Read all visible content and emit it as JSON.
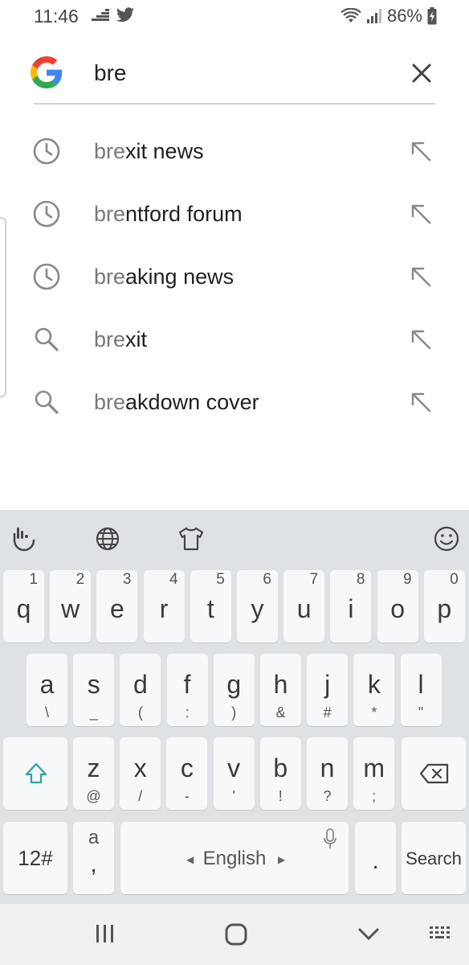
{
  "status": {
    "time": "11:46",
    "battery": "86%"
  },
  "search": {
    "query": "bre"
  },
  "suggestions": [
    {
      "type": "history",
      "prefix": "bre",
      "rest": "xit news"
    },
    {
      "type": "history",
      "prefix": "bre",
      "rest": "ntford forum"
    },
    {
      "type": "history",
      "prefix": "bre",
      "rest": "aking news"
    },
    {
      "type": "search",
      "prefix": "bre",
      "rest": "xit"
    },
    {
      "type": "search",
      "prefix": "bre",
      "rest": "akdown cover"
    }
  ],
  "keyboard": {
    "row1": [
      {
        "k": "q",
        "n": "1"
      },
      {
        "k": "w",
        "n": "2"
      },
      {
        "k": "e",
        "n": "3"
      },
      {
        "k": "r",
        "n": "4"
      },
      {
        "k": "t",
        "n": "5"
      },
      {
        "k": "y",
        "n": "6"
      },
      {
        "k": "u",
        "n": "7"
      },
      {
        "k": "i",
        "n": "8"
      },
      {
        "k": "o",
        "n": "9"
      },
      {
        "k": "p",
        "n": "0"
      }
    ],
    "row2": [
      {
        "k": "a",
        "s": "\\"
      },
      {
        "k": "s",
        "s": "_"
      },
      {
        "k": "d",
        "s": "("
      },
      {
        "k": "f",
        "s": ":"
      },
      {
        "k": "g",
        "s": ")"
      },
      {
        "k": "h",
        "s": "&"
      },
      {
        "k": "j",
        "s": "#"
      },
      {
        "k": "k",
        "s": "*"
      },
      {
        "k": "l",
        "s": "\""
      }
    ],
    "row3": [
      {
        "k": "z",
        "s": "@"
      },
      {
        "k": "x",
        "s": "/"
      },
      {
        "k": "c",
        "s": "-"
      },
      {
        "k": "v",
        "s": "'"
      },
      {
        "k": "b",
        "s": "!"
      },
      {
        "k": "n",
        "s": "?"
      },
      {
        "k": "m",
        "s": ";"
      }
    ],
    "symbols_label": "12#",
    "comma_top": "a",
    "comma_label": ",",
    "space_label": "English",
    "period_label": ".",
    "search_label": "Search"
  }
}
